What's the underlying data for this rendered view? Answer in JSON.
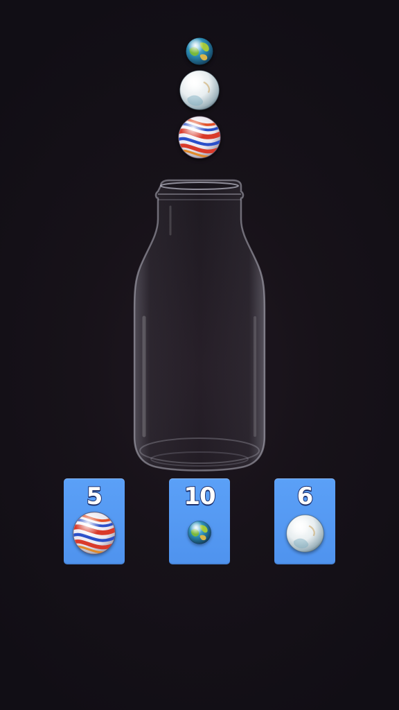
{
  "game": {
    "falling_marbles": [
      {
        "type": "earth-green-blue"
      },
      {
        "type": "pearl-white"
      },
      {
        "type": "swirl-red-blue"
      }
    ],
    "bottle": {
      "fill_level": 0
    },
    "cards": [
      {
        "count": "5",
        "marble_type": "swirl-red-blue"
      },
      {
        "count": "10",
        "marble_type": "earth-green-blue"
      },
      {
        "count": "6",
        "marble_type": "pearl-white"
      }
    ]
  },
  "colors": {
    "background": "#171219",
    "card": "#5ba0f7",
    "count_outline": "#1c2f6b",
    "count_text": "#ffffff"
  }
}
